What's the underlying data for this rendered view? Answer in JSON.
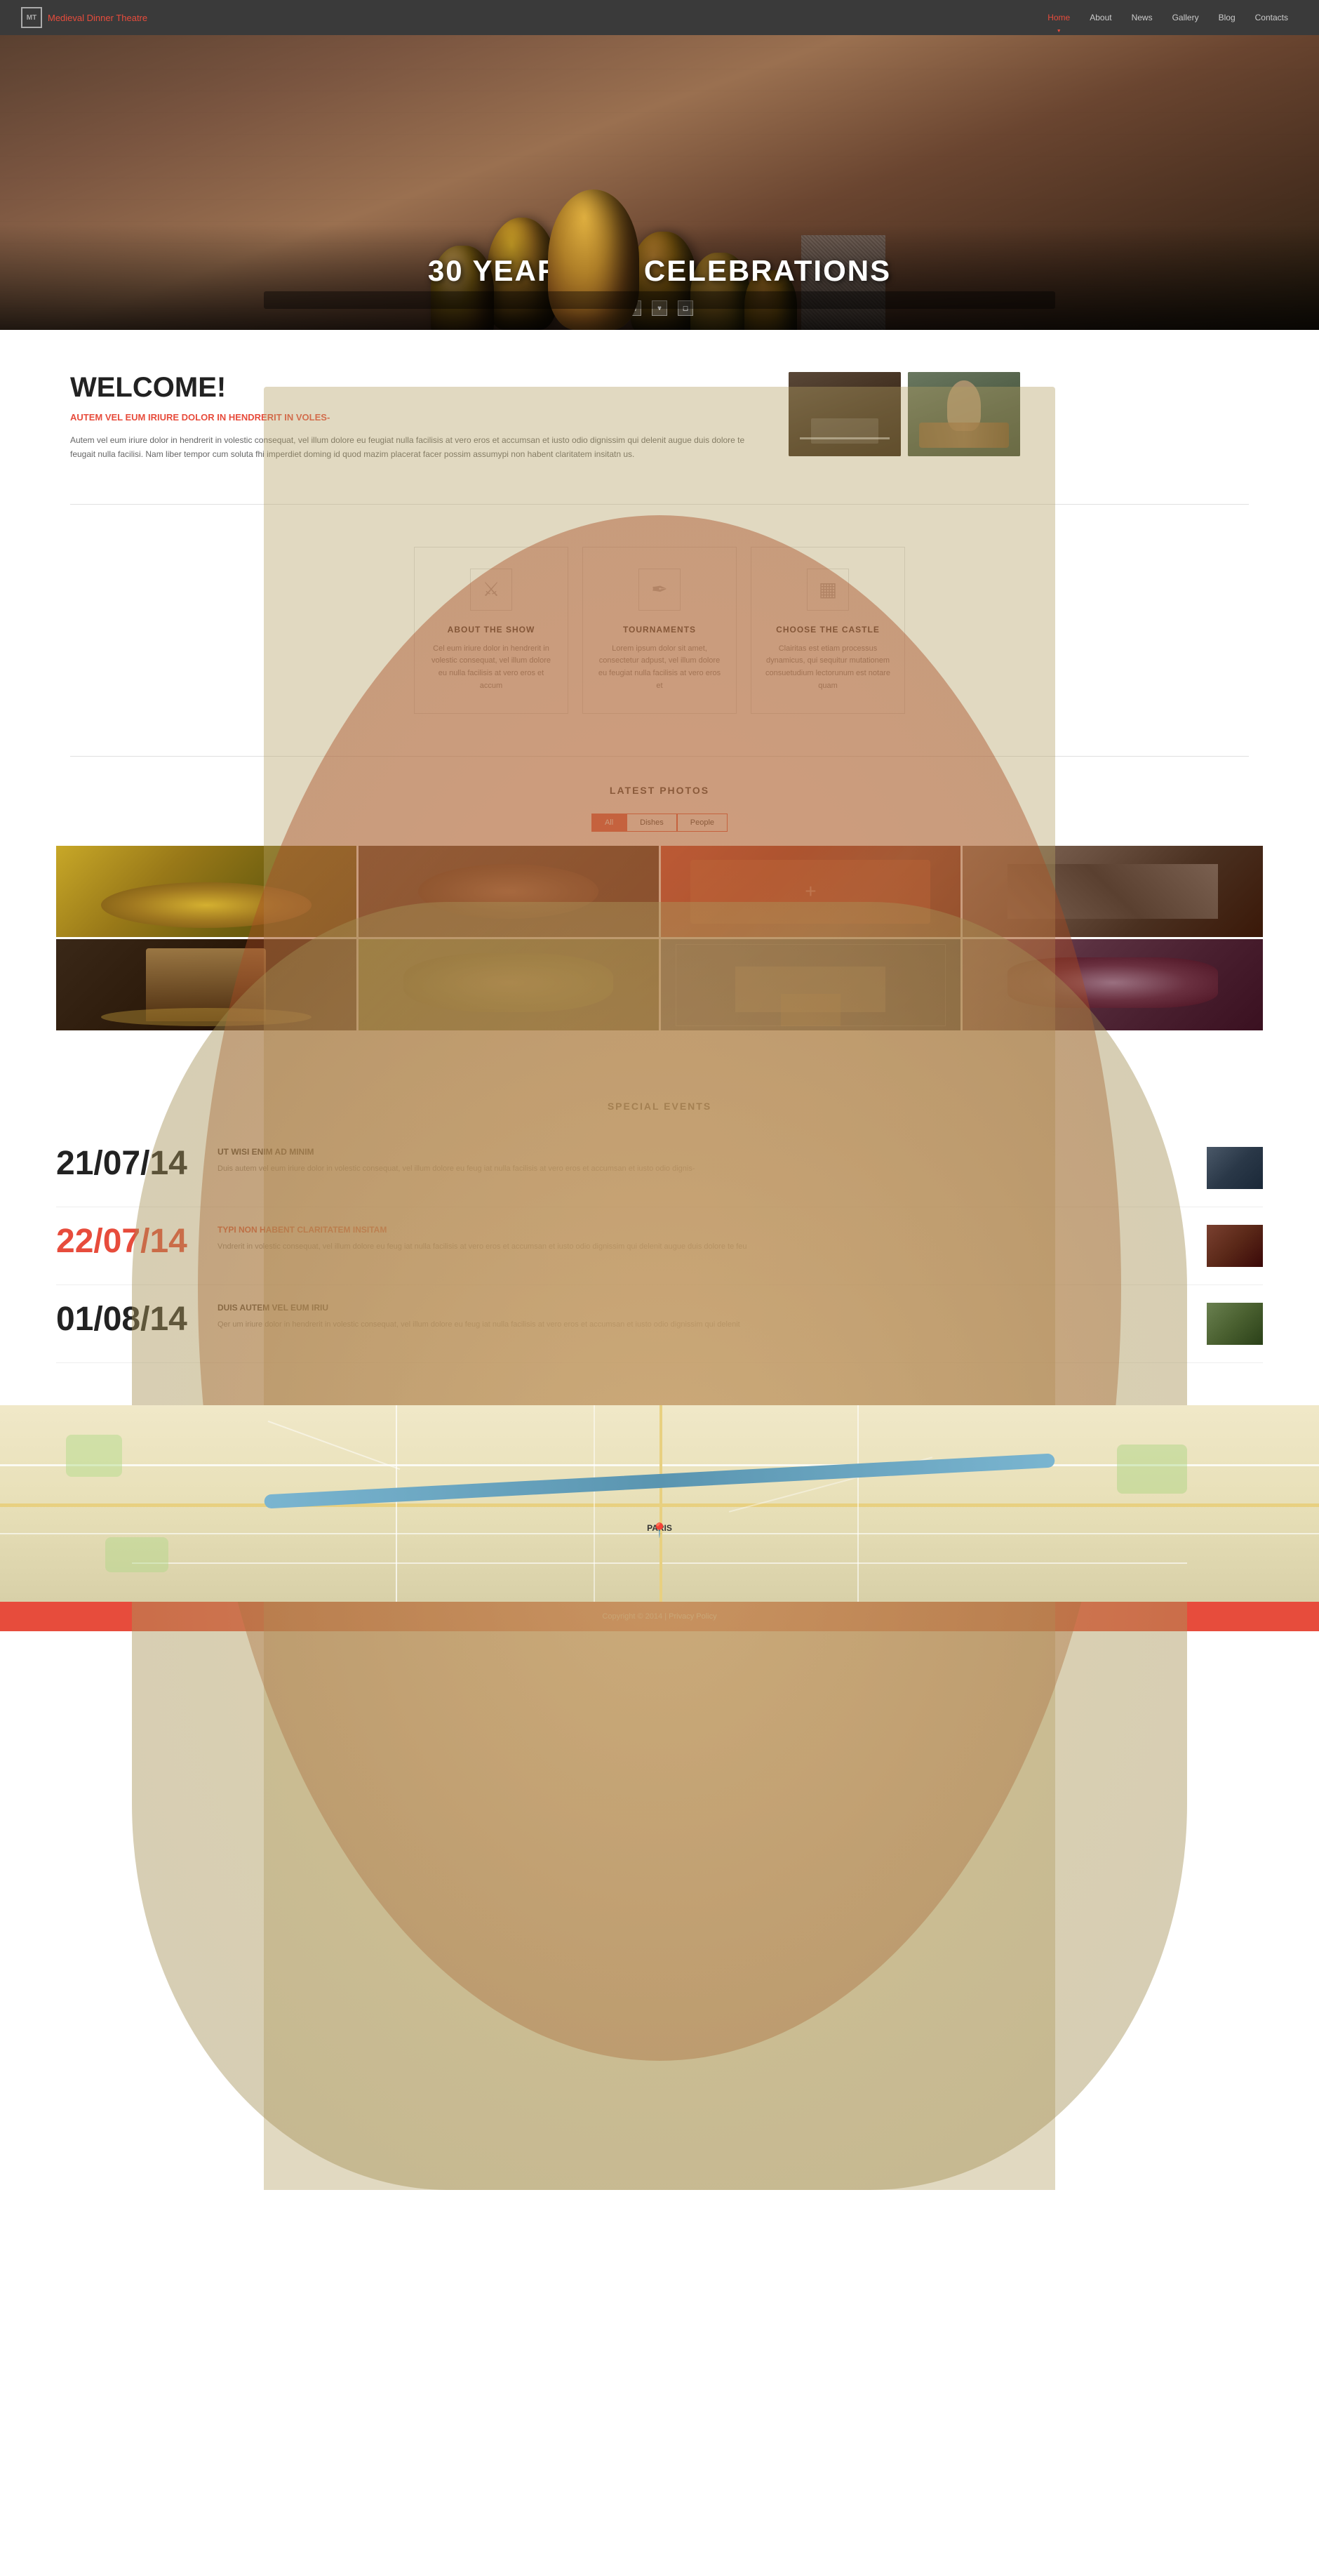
{
  "navbar": {
    "logo_initials": "MT",
    "brand_part1": "Medieval ",
    "brand_part2": "Dinner Theatre",
    "links": [
      {
        "label": "Home",
        "active": true
      },
      {
        "label": "About",
        "active": false
      },
      {
        "label": "News",
        "active": false
      },
      {
        "label": "Gallery",
        "active": false
      },
      {
        "label": "Blog",
        "active": false
      },
      {
        "label": "Contacts",
        "active": false
      }
    ]
  },
  "hero": {
    "title": "30 YEARS OF CELEBRATIONS"
  },
  "welcome": {
    "title": "WELCOME!",
    "subtitle": "AUTEM VEL EUM IRIURE DOLOR IN HENDRERIT IN VOLES-",
    "body": "Autem vel eum iriure dolor in hendrerit in volestic consequat, vel illum dolore eu feugiat nulla facilisis at vero eros et accumsan et iusto odio dignissim qui delenit augue duis dolore te feugait nulla facilisi. Nam liber tempor cum soluta fhi imperdiet doming id quod mazim placerat facer possim assumypi non habent claritatem insitatn us."
  },
  "features": [
    {
      "title": "ABOUT THE SHOW",
      "text": "Cel eum iriure dolor in hendrerit in volestic consequat, vel illum dolore eu nulla facilisis at vero eros et accum",
      "icon": "⚔"
    },
    {
      "title": "TOURNAMENTS",
      "text": "Lorem ipsum dolor sit amet, consectetur adpust, vel illum dolore eu feugiat nulla facilisis at vero eros et",
      "icon": "✒"
    },
    {
      "title": "CHOOSE THE CASTLE",
      "text": "Clairitas est etiam processus dynamicus, qui sequitur mutationem consuetudium lectorunum est notare quam",
      "icon": "▦"
    }
  ],
  "gallery": {
    "title": "LATEST PHOTOS",
    "filters": [
      "All",
      "Dishes",
      "People"
    ],
    "active_filter": "All"
  },
  "events": {
    "title": "SPECIAL EVENTS",
    "items": [
      {
        "date": "21/07/14",
        "date_color": "dark",
        "title": "UT WISI ENIM AD MINIM",
        "title_color": "dark",
        "text": "Duis autem vel eum iriure dolor in volestic consequat, vel illum dolore eu feug iat nulla facilisis at vero eros et accumsan et iusto odio dignis-"
      },
      {
        "date": "22/07/14",
        "date_color": "red",
        "title": "TYPI NON HABENT CLARITATEM INSITAM",
        "title_color": "red",
        "text": "Vndrerit in volestic consequat, vel illum dolore eu feug iat nulla facilisis at vero eros et accumsan et iusto odio dignissim qui  delenit augue duis dolore te feu"
      },
      {
        "date": "01/08/14",
        "date_color": "dark",
        "title": "DUIS AUTEM VEL EUM IRIU",
        "title_color": "dark",
        "text": "Qer um iriure dolor in hendrerit in volestic consequat, vel illum dolore eu feug iat nulla facilisis at vero eros et accumsan et iusto odio dignissim qui  delenit"
      }
    ]
  },
  "map": {
    "city_label": "PARIS"
  },
  "footer": {
    "copyright": "Copyright © 2014 |",
    "policy_link": "Privacy Policy"
  }
}
